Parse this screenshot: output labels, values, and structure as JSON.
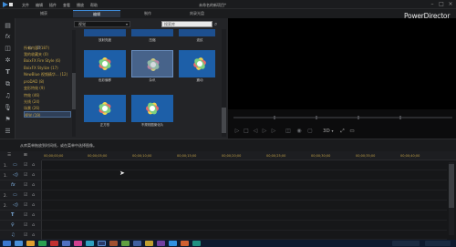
{
  "menu": [
    "文件",
    "编辑",
    "插件",
    "查看",
    "播放",
    "帮助"
  ],
  "window_title": "未命名的新项目*",
  "window_controls": [
    "minimize-icon",
    "maximize-icon",
    "close-icon"
  ],
  "mode_tabs": [
    "捕获",
    "编辑",
    "制作",
    "刻录光盘"
  ],
  "brand": "PowerDirector",
  "left_tools": [
    "media-room-icon",
    "fx-icon",
    "pip-icon",
    "particle-icon",
    "title-icon",
    "transition-icon",
    "audio-mixing-icon",
    "voiceover-icon",
    "chapter-icon",
    "subtitle-icon"
  ],
  "library": {
    "dropdown_value": "视觉",
    "search_placeholder": "搜索库",
    "categories": [
      {
        "label": "所有内容 (187)",
        "selected": false
      },
      {
        "label": "我的收藏夹 (0)",
        "selected": false
      },
      {
        "label": "BoixFX Fire Style (6)",
        "selected": false
      },
      {
        "label": "BoixFX Stylize (17)",
        "selected": false
      },
      {
        "label": "NewBlue 视频精华... (12)",
        "selected": false
      },
      {
        "label": "proDAD (8)",
        "selected": false
      },
      {
        "label": "变形特效 (9)",
        "selected": false
      },
      {
        "label": "特效 (46)",
        "selected": false
      },
      {
        "label": "光线 (24)",
        "selected": false
      },
      {
        "label": "场景 (26)",
        "selected": false
      },
      {
        "label": "视觉 (19)",
        "selected": true
      }
    ],
    "effects": [
      {
        "label": "放射亮度"
      },
      {
        "label": "压缩"
      },
      {
        "label": "波纹"
      },
      {
        "label": "色彩偏移"
      },
      {
        "label": "杂讯"
      },
      {
        "label": "震动"
      },
      {
        "label": "正方形"
      },
      {
        "label": "不规则图案化片"
      }
    ]
  },
  "preview": {
    "view_label": "3D"
  },
  "status_hint": "从库菜单拖放到时间线，或在菜单中选择图像。",
  "timeline": {
    "ticks": [
      "00;00;00;00",
      "00;00;05;00",
      "00;00;10;00",
      "00;00;15;00",
      "00;00;20;00",
      "00;00;25;00",
      "00;00;30;00",
      "00;00;35;00",
      "00;00;40;00"
    ],
    "tracks": [
      {
        "num": "1.",
        "icon": "video-track-icon"
      },
      {
        "num": "1.",
        "icon": "audio-track-icon"
      },
      {
        "num": "",
        "icon": "fx-track-icon"
      },
      {
        "num": "2.",
        "icon": "video-track-icon"
      },
      {
        "num": "2.",
        "icon": "audio-track-icon"
      },
      {
        "num": "",
        "icon": "title-track-icon"
      },
      {
        "num": "",
        "icon": "voice-track-icon"
      },
      {
        "num": "",
        "icon": "music-track-icon"
      }
    ]
  },
  "colors": {
    "accent": "#3d8bd9",
    "category_text": "#c3a247",
    "tile_bg": "#1d4f8e",
    "background": "#151618"
  }
}
